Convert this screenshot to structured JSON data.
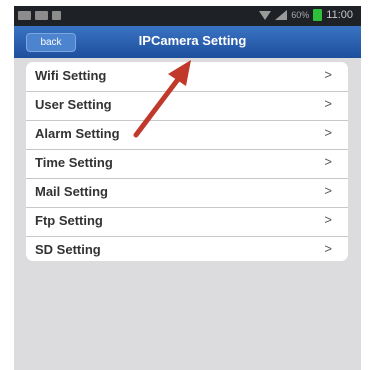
{
  "status_bar": {
    "battery_percent": "60%",
    "time": "11:00"
  },
  "header": {
    "back_label": "back",
    "title": "IPCamera  Setting"
  },
  "menu": {
    "items": [
      {
        "label": "Wifi Setting",
        "chevron": ">"
      },
      {
        "label": "User Setting",
        "chevron": ">"
      },
      {
        "label": "Alarm Setting",
        "chevron": ">"
      },
      {
        "label": "Time Setting",
        "chevron": ">"
      },
      {
        "label": "Mail Setting",
        "chevron": ">"
      },
      {
        "label": "Ftp Setting",
        "chevron": ">"
      },
      {
        "label": "SD Setting",
        "chevron": ">"
      }
    ]
  },
  "colors": {
    "title_bar": "#1d4f9c",
    "annotation_arrow": "#c0392b"
  }
}
